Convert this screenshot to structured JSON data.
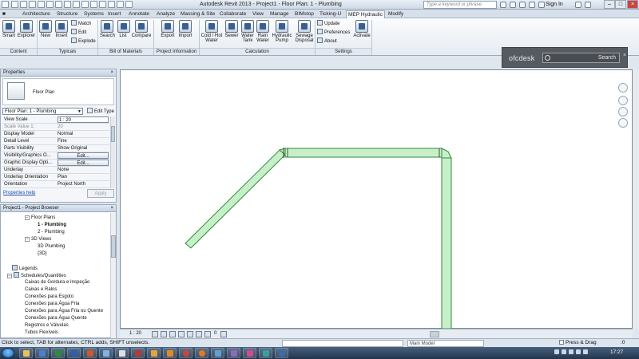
{
  "window": {
    "title": "Autodesk Revit 2013 -     Project1 - Floor Plan: 1 - Plumbing",
    "search_placeholder": "Type a keyword or phrase",
    "sign_in": "Sign In",
    "min": "–",
    "max": "□",
    "close": "×"
  },
  "ribbon_tabs": [
    "Architecture",
    "Structure",
    "Systems",
    "Insert",
    "Annotate",
    "Analyze",
    "Massing & Site",
    "Collaborate",
    "View",
    "Manage",
    "BIMstop",
    "Ticking-U",
    "MEP Hydraulic",
    "Modify"
  ],
  "ribbon": {
    "content": {
      "label": "Content",
      "buttons": [
        "Smart",
        "Explorer"
      ]
    },
    "typicals": {
      "label": "Typicals",
      "buttons": [
        "New",
        "Insert"
      ],
      "small": [
        "Match",
        "Edit",
        "Explode"
      ]
    },
    "bom": {
      "label": "Bill of Materials",
      "buttons": [
        "Search",
        "List",
        "Compare"
      ]
    },
    "projinfo": {
      "label": "Project Information",
      "buttons": [
        "Export",
        "Import"
      ]
    },
    "calc": {
      "label": "Calculation",
      "buttons": [
        "Cold / Hot Water",
        "Sewer",
        "Water Tank",
        "Rain Water",
        "Hydraulic Pump",
        "Sewage Disposal"
      ]
    },
    "settings": {
      "label": "Settings",
      "small": [
        "Update",
        "Preferences",
        "About"
      ],
      "buttons": [
        "Activate"
      ]
    }
  },
  "ofcdesk": {
    "brand": "ofcdesk",
    "search_label": "Search",
    "close": "×"
  },
  "properties": {
    "title": "Properties",
    "close": "×",
    "type_name": "Floor Plan",
    "instance": "Floor Plan: 1 - Plumbing",
    "edit_type": "Edit Type",
    "rows": [
      {
        "k": "View Scale",
        "v": "1 : 20"
      },
      {
        "k": "Scale Value    1:",
        "v": "20"
      },
      {
        "k": "Display Model",
        "v": "Normal"
      },
      {
        "k": "Detail Level",
        "v": "Fine"
      },
      {
        "k": "Parts Visibility",
        "v": "Show Original"
      },
      {
        "k": "Visibility/Graphics O...",
        "v": "Edit..."
      },
      {
        "k": "Graphic Display Opti...",
        "v": "Edit..."
      },
      {
        "k": "Underlay",
        "v": "None"
      },
      {
        "k": "Underlay Orientation",
        "v": "Plan"
      },
      {
        "k": "Orientation",
        "v": "Project North"
      }
    ],
    "help": "Properties help",
    "apply": "Apply"
  },
  "browser": {
    "title": "Project1 - Project Browser",
    "close": "×",
    "items": [
      {
        "t": "Floor Plans",
        "lvl": 2,
        "bx": "−"
      },
      {
        "t": "1 - Plumbing",
        "lvl": 3,
        "sel": true
      },
      {
        "t": "2 - Plumbing",
        "lvl": 3
      },
      {
        "t": "3D Views",
        "lvl": 2,
        "bx": "−"
      },
      {
        "t": "3D Plumbing",
        "lvl": 3
      },
      {
        "t": "{3D}",
        "lvl": 3
      },
      {
        "t": "",
        "lvl": 0
      },
      {
        "t": "Legends",
        "lvl": 1,
        "ic": true
      },
      {
        "t": "Schedules/Quantities",
        "lvl": 0,
        "bx": "−",
        "ic": true
      },
      {
        "t": "Caixas de Gordura e Inspeção",
        "lvl": 2
      },
      {
        "t": "Caixas e Ralos",
        "lvl": 2
      },
      {
        "t": "Conexões para Esgoto",
        "lvl": 2
      },
      {
        "t": "Conexões para Água Fria",
        "lvl": 2
      },
      {
        "t": "Conexões para Água Fria ou Quente",
        "lvl": 2
      },
      {
        "t": "Conexões para Água Quente",
        "lvl": 2
      },
      {
        "t": "Registros e Válvulas",
        "lvl": 2
      },
      {
        "t": "Tubos Flexíveis",
        "lvl": 2
      }
    ]
  },
  "viewctrl": {
    "scale": "1 : 20",
    "hidden_count": "0"
  },
  "status": {
    "message": "Click to select, TAB for alternates, CTRL adds, SHIFT unselects.",
    "model": "Main Model",
    "press_drag": "Press & Drag",
    "filter": ":0"
  },
  "taskbar": {
    "clock": "17:27"
  },
  "colors": {
    "pipe_fill": "#c8f0c8",
    "pipe_stroke": "#2f8a3c",
    "accent": "#3a5f8f"
  }
}
